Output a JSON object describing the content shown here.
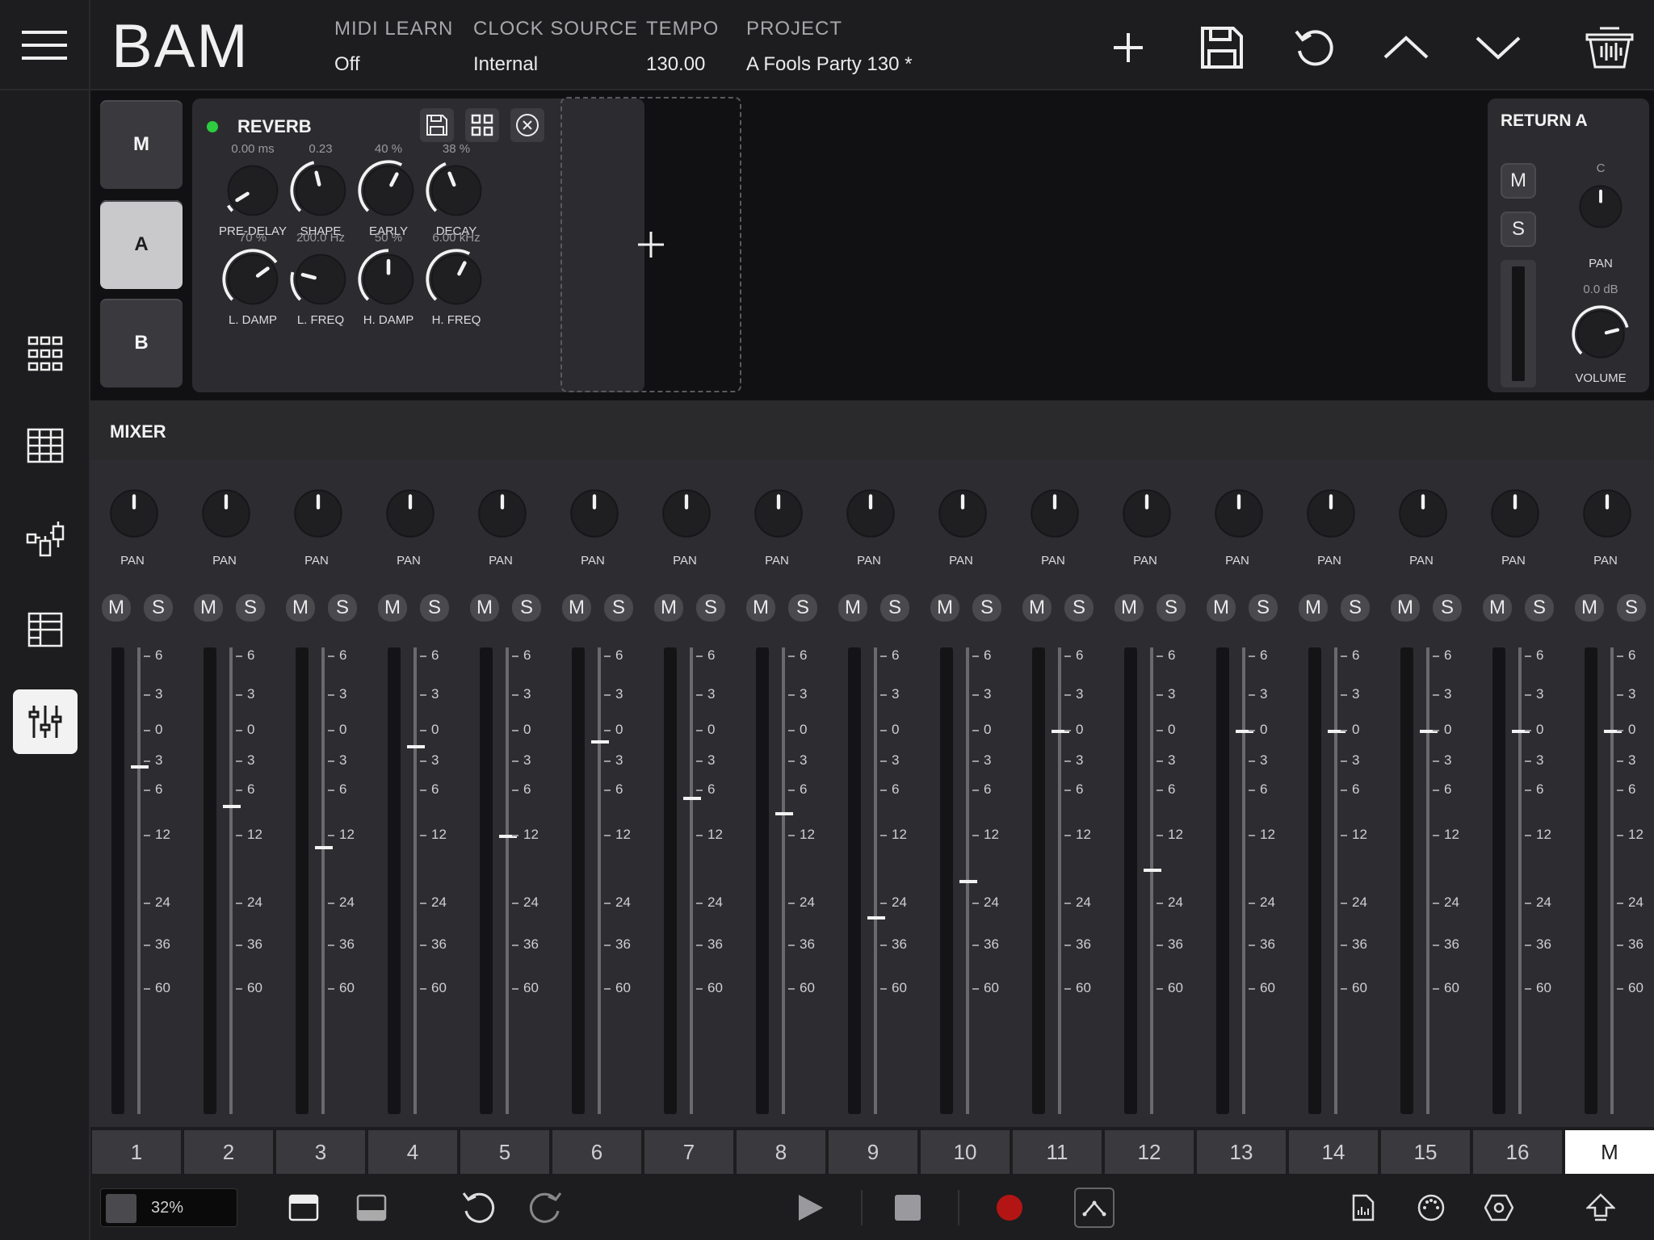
{
  "app": {
    "brand": "BAM"
  },
  "header": {
    "fields": [
      {
        "key": "MIDI LEARN",
        "value": "Off"
      },
      {
        "key": "CLOCK SOURCE",
        "value": "Internal"
      },
      {
        "key": "TEMPO",
        "value": "130.00"
      },
      {
        "key": "PROJECT",
        "value": "A Fools Party 130 *"
      }
    ],
    "icons": [
      "add-icon",
      "save-icon",
      "undo-icon",
      "chevron-up-icon",
      "chevron-down-icon",
      "trash-icon"
    ]
  },
  "sidebar": {
    "items": [
      "grid-icon",
      "sequencer-icon",
      "routing-icon",
      "arrangement-icon",
      "mixer-icon"
    ],
    "active": "mixer-icon"
  },
  "chain": {
    "buttons": [
      "M",
      "A",
      "B"
    ],
    "active": "A"
  },
  "reverb": {
    "title": "REVERB",
    "enabled": true,
    "knobs": [
      {
        "label": "PRE-DELAY",
        "value": "0.00 ms",
        "level": 0.05
      },
      {
        "label": "SHAPE",
        "value": "0.23",
        "level": 0.45
      },
      {
        "label": "EARLY",
        "value": "40 %",
        "level": 0.6
      },
      {
        "label": "DECAY",
        "value": "38 %",
        "level": 0.42
      },
      {
        "label": "L. DAMP",
        "value": "70 %",
        "level": 0.7
      },
      {
        "label": "L. FREQ",
        "value": "200.0 Hz",
        "level": 0.22
      },
      {
        "label": "H. DAMP",
        "value": "50 %",
        "level": 0.5
      },
      {
        "label": "H. FREQ",
        "value": "6.00 kHz",
        "level": 0.6
      }
    ]
  },
  "return_a": {
    "title": "RETURN A",
    "mute": "M",
    "solo": "S",
    "pan_value": "C",
    "pan_label": "PAN",
    "volume_value": "0.0 dB",
    "volume_label": "VOLUME"
  },
  "mixer": {
    "title": "MIXER",
    "pan_label": "PAN",
    "mute_label": "M",
    "solo_label": "S",
    "scale": [
      "6",
      "3",
      "0",
      "3",
      "6",
      "12",
      "24",
      "36",
      "60"
    ],
    "fader_db": [
      -3.5,
      -8,
      -14,
      -1.5,
      -12,
      -1,
      -7,
      -9,
      -28,
      -20,
      0,
      -18,
      0,
      0,
      0,
      0,
      0
    ]
  },
  "tracks": {
    "tabs": [
      "1",
      "2",
      "3",
      "4",
      "5",
      "6",
      "7",
      "8",
      "9",
      "10",
      "11",
      "12",
      "13",
      "14",
      "15",
      "16",
      "M"
    ],
    "active": "M"
  },
  "transport": {
    "cpu": "32%"
  }
}
